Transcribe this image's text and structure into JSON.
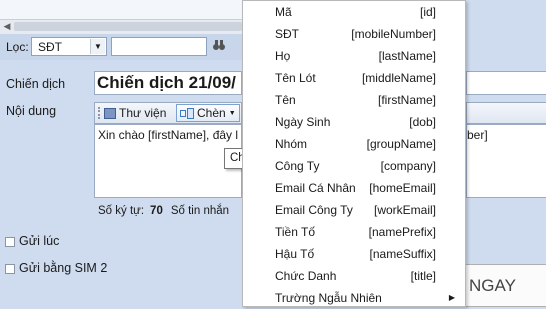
{
  "filter": {
    "label": "Lọc:",
    "selected": "SĐT"
  },
  "form": {
    "campaign_label": "Chiến dịch",
    "campaign_value": "Chiến dịch 21/09/",
    "content_label": "Nội dung",
    "toolbar": {
      "library_label": "Thư viện",
      "insert_label": "Chèn"
    },
    "message_left": "Xin chào [firstName], đây l",
    "message_right": "ber]",
    "tooltip": "Chèn",
    "char_count_label": "Số ký tự:",
    "char_count_value": "70",
    "sms_count_label": "Số tin nhắn"
  },
  "options": {
    "send_at_label": "Gửi lúc",
    "send_sim2_label": "Gửi bằng SIM 2"
  },
  "send_button": {
    "label": "NGAY"
  },
  "insert_menu": [
    {
      "label": "Mã",
      "field": "[id]"
    },
    {
      "label": "SĐT",
      "field": "[mobileNumber]"
    },
    {
      "label": "Họ",
      "field": "[lastName]"
    },
    {
      "label": "Tên Lót",
      "field": "[middleName]"
    },
    {
      "label": "Tên",
      "field": "[firstName]"
    },
    {
      "label": "Ngày Sinh",
      "field": "[dob]"
    },
    {
      "label": "Nhóm",
      "field": "[groupName]"
    },
    {
      "label": "Công Ty",
      "field": "[company]"
    },
    {
      "label": "Email Cá Nhân",
      "field": "[homeEmail]"
    },
    {
      "label": "Email Công Ty",
      "field": "[workEmail]"
    },
    {
      "label": "Tiền Tố",
      "field": "[namePrefix]"
    },
    {
      "label": "Hậu Tố",
      "field": "[nameSuffix]"
    },
    {
      "label": "Chức Danh",
      "field": "[title]"
    },
    {
      "label": "Trường Ngẫu Nhiên",
      "field": ""
    }
  ]
}
